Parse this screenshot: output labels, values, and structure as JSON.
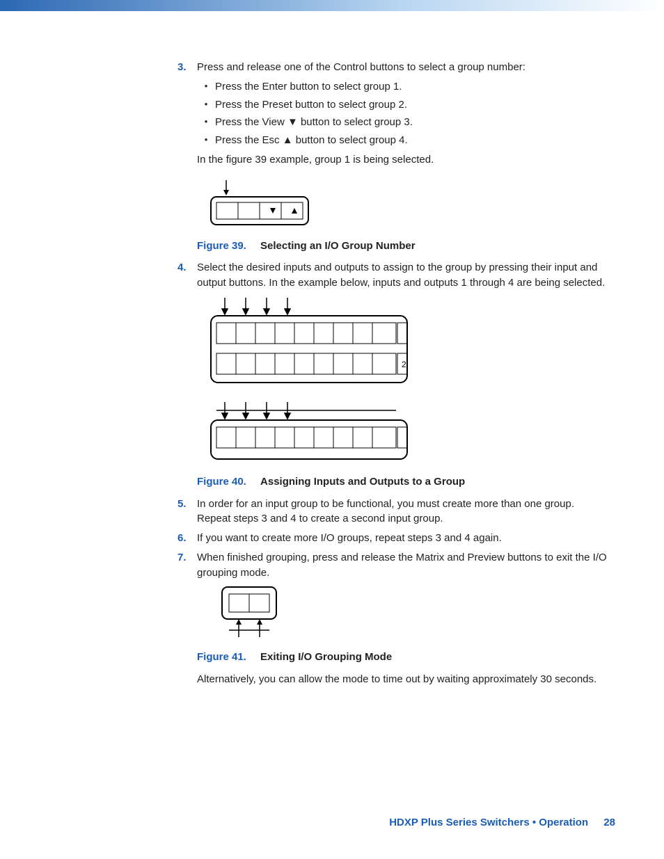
{
  "steps": {
    "s3": {
      "num": "3.",
      "text": "Press and release one of the Control buttons to select a group number:",
      "bullets": [
        "Press the Enter button to select group 1.",
        "Press the Preset button to select group 2.",
        "Press the View ▼ button to select group 3.",
        "Press the Esc ▲ button to select group 4."
      ],
      "after": "In the figure 39 example, group 1 is being selected."
    },
    "fig39": {
      "num": "Figure 39.",
      "title": "Selecting an I/O Group Number"
    },
    "s4": {
      "num": "4.",
      "text": "Select the desired inputs and outputs to assign to the group by pressing their input and output buttons. In the example below, inputs and outputs 1 through 4 are being selected."
    },
    "fig40": {
      "num": "Figure 40.",
      "title": "Assigning Inputs and Outputs to a Group"
    },
    "s5": {
      "num": "5.",
      "text": "In order for an input group to be functional, you must create more than one group. Repeat steps 3 and 4 to create a second input group."
    },
    "s6": {
      "num": "6.",
      "text": "If you want to create more I/O groups, repeat steps 3 and 4 again."
    },
    "s7": {
      "num": "7.",
      "text": "When finished grouping, press and release the Matrix and Preview buttons to exit the I/O grouping mode."
    },
    "fig41": {
      "num": "Figure 41.",
      "title": "Exiting I/O Grouping Mode"
    },
    "alt": "Alternatively, you can allow the mode to time out by waiting approximately 30 seconds."
  },
  "footer": {
    "text": "HDXP Plus Series Switchers • Operation",
    "page": "28"
  }
}
